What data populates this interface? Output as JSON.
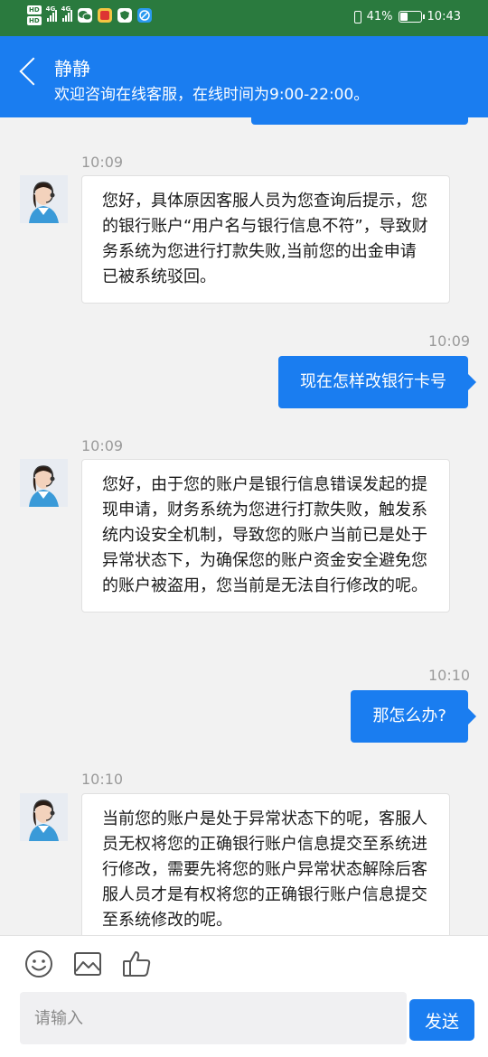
{
  "status_bar": {
    "battery_percent": "41%",
    "battery_level": 0.41,
    "time": "10:43",
    "network_labels": [
      "HD",
      "HD",
      "4G",
      "4G"
    ],
    "icons": [
      "wechat-icon",
      "app-icon",
      "shield-icon",
      "browser-icon",
      "vibrate-icon",
      "battery-icon"
    ]
  },
  "header": {
    "agent_name": "静静",
    "welcome_text": "欢迎咨询在线客服，在线时间为9:00-22:00。"
  },
  "messages": [
    {
      "side": "agent",
      "time": "10:09",
      "text": "您好，具体原因客服人员为您查询后提示，您的银行账户“用户名与银行信息不符”，导致财务系统为您进行打款失败,当前您的出金申请已被系统驳回。"
    },
    {
      "side": "user",
      "time": "10:09",
      "text": "现在怎样改银行卡号"
    },
    {
      "side": "agent",
      "time": "10:09",
      "text": "您好，由于您的账户是银行信息错误发起的提现申请，财务系统为您进行打款失败，触发系统内设安全机制，导致您的账户当前已是处于异常状态下，为确保您的账户资金安全避免您的账户被盗用，您当前是无法自行修改的呢。"
    },
    {
      "side": "user",
      "time": "10:10",
      "text": "那怎么办?"
    },
    {
      "side": "agent",
      "time": "10:10",
      "text": "当前您的账户是处于异常状态下的呢，客服人员无权将您的正确银行账户信息提交至系统进行修改，需要先将您的账户异常状态解除后客服人员才是有权将您的正确银行账户信息提交至系统修改的呢。"
    }
  ],
  "input": {
    "placeholder": "请输入",
    "value": "",
    "send_label": "发送"
  },
  "toolbar_icons": [
    "emoji-icon",
    "image-icon",
    "thumbs-up-icon"
  ],
  "colors": {
    "accent": "#1a7df0",
    "status_bar": "#2a7a3e",
    "chat_background": "#f2f2f2"
  }
}
